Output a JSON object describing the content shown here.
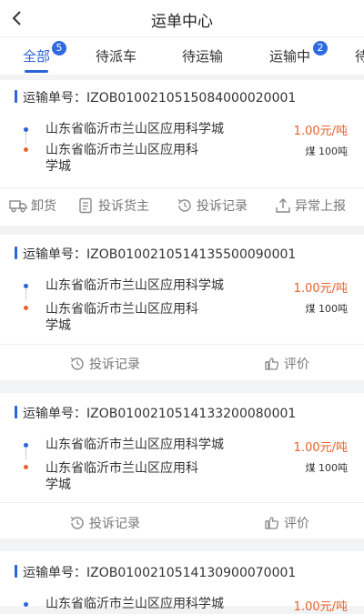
{
  "header": {
    "title": "运单中心"
  },
  "tabs": [
    {
      "label": "全部",
      "badge": "5"
    },
    {
      "label": "待派车"
    },
    {
      "label": "待运输"
    },
    {
      "label": "运输中",
      "badge": "2"
    },
    {
      "label": "待"
    }
  ],
  "orders": [
    {
      "order_no": "运输单号：IZOB0100210515084000020001",
      "from": "山东省临沂市兰山区应用科学城",
      "to_line1": "山东省临沂市兰山区应用科",
      "to_line2": "学城",
      "price": "1.00元/吨",
      "goods": "煤 100吨",
      "actions": [
        "卸货",
        "投诉货主",
        "投诉记录",
        "异常上报"
      ]
    },
    {
      "order_no": "运输单号：IZOB0100210514135500090001",
      "from": "山东省临沂市兰山区应用科学城",
      "to_line1": "山东省临沂市兰山区应用科",
      "to_line2": "学城",
      "price": "1.00元/吨",
      "goods": "煤 100吨",
      "actions": [
        "投诉记录",
        "评价"
      ]
    },
    {
      "order_no": "运输单号：IZOB0100210514133200080001",
      "from": "山东省临沂市兰山区应用科学城",
      "to_line1": "山东省临沂市兰山区应用科",
      "to_line2": "学城",
      "price": "1.00元/吨",
      "goods": "煤 100吨",
      "actions": [
        "投诉记录",
        "评价"
      ]
    },
    {
      "order_no": "运输单号：IZOB0100210514130900070001",
      "from": "山东省临沂市兰山区应用科学城",
      "price": "1.00元/吨"
    }
  ],
  "colors": {
    "accent": "#2b63d9",
    "price": "#e8622c"
  }
}
